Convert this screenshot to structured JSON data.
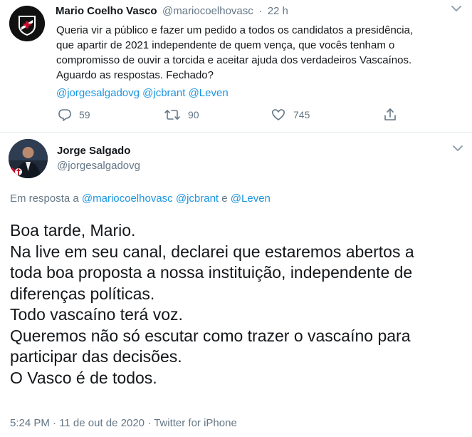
{
  "tweet1": {
    "author_name": "Mario Coelho Vasco",
    "handle": "@mariocoelhovasc",
    "separator": "·",
    "time": "22 h",
    "lines": [
      "Queria vir a público e fazer um pedido a todos os candidatos a presidência,",
      "que apartir de 2021 independente de quem vença, que vocês tenham o",
      "compromisso de ouvir a torcida e aceitar ajuda dos verdadeiros Vascaínos.",
      "Aguardo as respostas. Fechado?"
    ],
    "mentions": [
      "@jorgesalgadovg",
      "@jcbrant",
      "@Leven"
    ],
    "reply_count": "59",
    "retweet_count": "90",
    "like_count": "745"
  },
  "tweet2": {
    "author_name": "Jorge Salgado",
    "handle": "@jorgesalgadovg",
    "reply_prefix": "Em resposta a",
    "reply_to_1": "@mariocoelhovasc",
    "reply_to_2": "@jcbrant",
    "reply_conj": "e",
    "reply_to_3": "@Leven",
    "lines": [
      "Boa tarde, Mario.",
      "Na live em seu canal, declarei que estaremos abertos a",
      "toda boa proposta a nossa instituição, independente de",
      "diferenças políticas.",
      "Todo vascaíno terá voz.",
      "Queremos não só escutar como trazer o vascaíno para",
      "participar das decisões.",
      "O Vasco é de todos."
    ],
    "timestamp": "5:24 PM · 11 de out de 2020 · Twitter for iPhone"
  }
}
